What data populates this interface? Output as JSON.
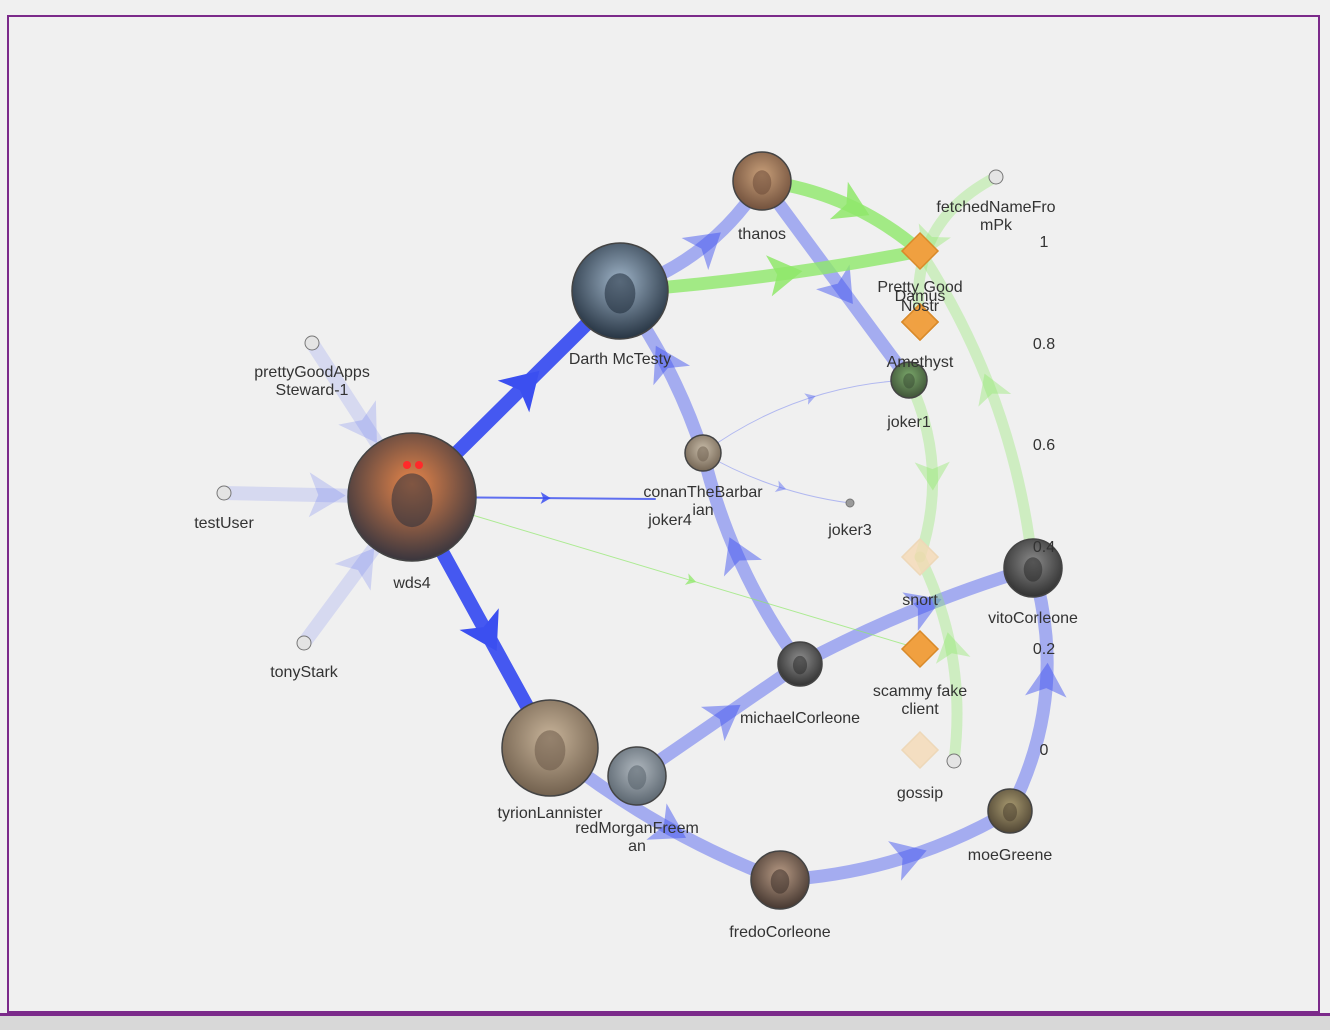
{
  "nodes": [
    {
      "id": "wds4",
      "label_lines": [
        "wds4"
      ],
      "kind": "user",
      "size": "xl",
      "avatar": "sunset-silhouette-avatar",
      "tone": [
        "#e8864a",
        "#2b2f3d"
      ]
    },
    {
      "id": "darth",
      "label_lines": [
        "Darth McTesty"
      ],
      "kind": "user",
      "size": "lg",
      "avatar": "darth-vader-avatar",
      "tone": [
        "#9fb4c8",
        "#1d2a38"
      ]
    },
    {
      "id": "tyrion",
      "label_lines": [
        "tyrionLannister"
      ],
      "kind": "user",
      "size": "lg",
      "avatar": "tyrion-avatar",
      "tone": [
        "#c8b49a",
        "#6b5a48"
      ]
    },
    {
      "id": "thanos",
      "label_lines": [
        "thanos"
      ],
      "kind": "user",
      "size": "md",
      "avatar": "thanos-avatar",
      "tone": [
        "#c9a07a",
        "#6b4b38"
      ]
    },
    {
      "id": "vito",
      "label_lines": [
        "vitoCorleone"
      ],
      "kind": "user",
      "size": "md",
      "avatar": "vito-avatar",
      "tone": [
        "#8a8a8a",
        "#2a2a2a"
      ]
    },
    {
      "id": "fredo",
      "label_lines": [
        "fredoCorleone"
      ],
      "kind": "user",
      "size": "md",
      "avatar": "fredo-avatar",
      "tone": [
        "#b79a84",
        "#3d302a"
      ]
    },
    {
      "id": "red",
      "label_lines": [
        "redMorganFreem",
        "an"
      ],
      "kind": "user",
      "size": "md",
      "avatar": "red-avatar",
      "tone": [
        "#b0b8bf",
        "#55606a"
      ]
    },
    {
      "id": "michael",
      "label_lines": [
        "michaelCorleone"
      ],
      "kind": "user",
      "size": "sm",
      "avatar": "michael-avatar",
      "tone": [
        "#8d8d8d",
        "#2b2b2b"
      ]
    },
    {
      "id": "moe",
      "label_lines": [
        "moeGreene"
      ],
      "kind": "user",
      "size": "sm",
      "avatar": "moe-avatar",
      "tone": [
        "#a89a70",
        "#4a4030"
      ]
    },
    {
      "id": "conan",
      "label_lines": [
        "conanTheBarbar",
        "ian"
      ],
      "kind": "user",
      "size": "xs",
      "avatar": "conan-avatar",
      "tone": [
        "#c7bba8",
        "#6e5f4e"
      ]
    },
    {
      "id": "joker1",
      "label_lines": [
        "joker1"
      ],
      "kind": "user",
      "size": "xs",
      "avatar": "joker-avatar",
      "tone": [
        "#7aa86a",
        "#3b4d34"
      ]
    },
    {
      "id": "joker3",
      "label_lines": [
        "joker3"
      ],
      "kind": "user",
      "size": "dot",
      "avatar": "small-dot-icon",
      "tone": [
        "#999999",
        "#555555"
      ]
    },
    {
      "id": "joker4",
      "label_lines": [
        "joker4"
      ],
      "kind": "label-only",
      "size": "none",
      "avatar": "",
      "tone": [
        "#000000",
        "#000000"
      ]
    },
    {
      "id": "prettyGoodAppsSteward",
      "label_lines": [
        "prettyGoodApps",
        "Steward-1"
      ],
      "kind": "user",
      "size": "tiny",
      "avatar": "steward-icon",
      "tone": [
        "#dddddd",
        "#999999"
      ]
    },
    {
      "id": "testUser",
      "label_lines": [
        "testUser"
      ],
      "kind": "user",
      "size": "tiny",
      "avatar": "blank-user-icon",
      "tone": [
        "#dddddd",
        "#999999"
      ]
    },
    {
      "id": "tonyStark",
      "label_lines": [
        "tonyStark"
      ],
      "kind": "user",
      "size": "tiny",
      "avatar": "tony-icon",
      "tone": [
        "#e0d0c0",
        "#888888"
      ]
    },
    {
      "id": "fetchedNameFromPk",
      "label_lines": [
        "fetchedNameFro",
        "mPk"
      ],
      "kind": "user",
      "size": "tiny",
      "avatar": "blank-user-icon",
      "tone": [
        "#dddddd",
        "#999999"
      ]
    },
    {
      "id": "gossipUser",
      "label_lines": [],
      "kind": "user",
      "size": "tiny",
      "avatar": "blank-user-icon",
      "tone": [
        "#dddddd",
        "#999999"
      ]
    },
    {
      "id": "prettyGood",
      "label_lines": [
        "Pretty Good"
      ],
      "kind": "client",
      "strength": "strong"
    },
    {
      "id": "damus",
      "label_lines": [
        "Damus"
      ],
      "kind": "client",
      "strength": "medium"
    },
    {
      "id": "nostr",
      "label_lines": [
        "Nostr"
      ],
      "kind": "client",
      "strength": "medium"
    },
    {
      "id": "amethyst",
      "label_lines": [
        "Amethyst"
      ],
      "kind": "client",
      "strength": "medium"
    },
    {
      "id": "snort",
      "label_lines": [
        "snort"
      ],
      "kind": "client",
      "strength": "faint"
    },
    {
      "id": "scammy",
      "label_lines": [
        "scammy fake",
        "client"
      ],
      "kind": "client",
      "strength": "strong"
    },
    {
      "id": "gossip",
      "label_lines": [
        "gossip"
      ],
      "kind": "client",
      "strength": "faint"
    }
  ],
  "edges": [
    {
      "from": "wds4",
      "to": "darth",
      "color": "blue",
      "weight": "heavy"
    },
    {
      "from": "wds4",
      "to": "tyrion",
      "color": "blue",
      "weight": "heavy"
    },
    {
      "from": "darth",
      "to": "thanos",
      "color": "blue",
      "weight": "medium"
    },
    {
      "from": "thanos",
      "to": "joker1",
      "color": "blue",
      "weight": "medium"
    },
    {
      "from": "tyrion",
      "to": "fredo",
      "color": "blue",
      "weight": "medium"
    },
    {
      "from": "fredo",
      "to": "moe",
      "color": "blue",
      "weight": "medium"
    },
    {
      "from": "moe",
      "to": "vito",
      "color": "blue",
      "weight": "medium"
    },
    {
      "from": "red",
      "to": "michael",
      "color": "blue",
      "weight": "medium"
    },
    {
      "from": "michael",
      "to": "vito",
      "color": "blue",
      "weight": "medium"
    },
    {
      "from": "michael",
      "to": "conan",
      "color": "blue",
      "weight": "medium"
    },
    {
      "from": "conan",
      "to": "darth",
      "color": "blue",
      "weight": "medium"
    },
    {
      "from": "wds4",
      "to": "joker4",
      "color": "blue",
      "weight": "thin"
    },
    {
      "from": "conan",
      "to": "joker1",
      "color": "blue",
      "weight": "hair"
    },
    {
      "from": "conan",
      "to": "joker3",
      "color": "blue",
      "weight": "hair"
    },
    {
      "from": "prettyGoodAppsSteward",
      "to": "wds4",
      "color": "blue",
      "weight": "faint"
    },
    {
      "from": "testUser",
      "to": "wds4",
      "color": "blue",
      "weight": "faint"
    },
    {
      "from": "tonyStark",
      "to": "wds4",
      "color": "blue",
      "weight": "faint"
    },
    {
      "from": "darth",
      "to": "prettyGood",
      "color": "green",
      "weight": "medium"
    },
    {
      "from": "thanos",
      "to": "prettyGood",
      "color": "green",
      "weight": "medium"
    },
    {
      "from": "vito",
      "to": "prettyGood",
      "color": "green",
      "weight": "light"
    },
    {
      "from": "fetchedNameFromPk",
      "to": "amethyst",
      "color": "green",
      "weight": "light"
    },
    {
      "from": "joker1",
      "to": "snort",
      "color": "green",
      "weight": "light"
    },
    {
      "from": "gossipUser",
      "to": "snort",
      "color": "green",
      "weight": "light"
    },
    {
      "from": "wds4",
      "to": "scammy",
      "color": "green",
      "weight": "hair"
    }
  ],
  "scale": {
    "labels": [
      "1",
      "0.8",
      "0.6",
      "0.4",
      "0.2",
      "0"
    ]
  },
  "colors": {
    "blue_edge": "#3b4ff0",
    "green_edge": "#8fe86a",
    "client_strong": "#f0a040",
    "client_faint": "#f5d9b5",
    "frame": "#7b2a8a",
    "background": "#f0f0f0"
  }
}
